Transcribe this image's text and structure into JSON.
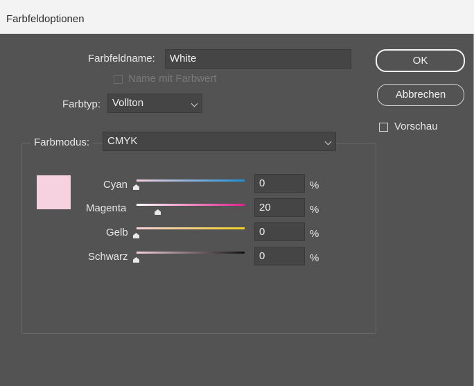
{
  "window": {
    "title": "Farbfeldoptionen"
  },
  "name_field": {
    "label": "Farbfeldname:",
    "value": "White"
  },
  "name_with_value": {
    "label": "Name mit Farbwert",
    "checked": false,
    "enabled": false
  },
  "color_type": {
    "label": "Farbtyp:",
    "value": "Vollton"
  },
  "color_mode": {
    "label": "Farbmodus:",
    "value": "CMYK"
  },
  "buttons": {
    "ok": "OK",
    "cancel": "Abbrechen"
  },
  "preview": {
    "label": "Vorschau",
    "checked": false
  },
  "swatch_color": "#f6d1df",
  "sliders": [
    {
      "label": "Cyan",
      "value": "0",
      "unit": "%",
      "level": 0
    },
    {
      "label": "Magenta",
      "value": "20",
      "unit": "%",
      "level": 0.2
    },
    {
      "label": "Gelb",
      "value": "0",
      "unit": "%",
      "level": 0
    },
    {
      "label": "Schwarz",
      "value": "0",
      "unit": "%",
      "level": 0
    }
  ],
  "colors": {
    "dialog_bg": "#535353",
    "field_bg": "#454545",
    "cyan_track": "#1e90d8",
    "magenta_track": "#e0208c",
    "yellow_track": "#f0d020",
    "black_track": "#111111"
  }
}
